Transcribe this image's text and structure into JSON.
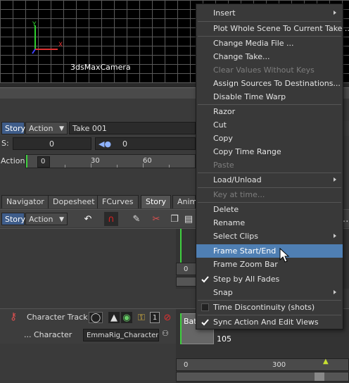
{
  "viewport": {
    "camera_label": "3dsMaxCamera"
  },
  "story_row": {
    "story": "Story",
    "action": "Action",
    "take": "Take 001"
  },
  "value_row": {
    "s_label": "S:",
    "s_value": "0",
    "field_value": "0"
  },
  "action_ruler": {
    "label": "Action",
    "start": "0",
    "ticks": [
      "30",
      "60"
    ]
  },
  "tabs": [
    "Navigator",
    "Dopesheet",
    "FCurves",
    "Story",
    "Anim"
  ],
  "toolbar": {
    "story": "Story",
    "action": "Action"
  },
  "lower_ruler": {
    "start": "0"
  },
  "tracks": {
    "character_track": "Character Track",
    "character_label": "Character",
    "character_value": "EmmaRig_Character",
    "badge": "1",
    "ellipsis": "..."
  },
  "timeline": {
    "clip_value": "105",
    "clip_prefix": "Bat",
    "bottom_start": "0",
    "bottom_mark": "300"
  },
  "context_menu": {
    "items": [
      {
        "label": "Insert",
        "submenu": true
      },
      {
        "label": "Plot Whole Scene To Current Take ..."
      },
      {
        "label": "Change Media File ..."
      },
      {
        "label": "Change Take..."
      },
      {
        "label": "Clear Values Without Keys",
        "disabled": true
      },
      {
        "label": "Assign Sources To Destinations..."
      },
      {
        "label": "Disable Time Warp"
      },
      {
        "label": "Razor"
      },
      {
        "label": "Cut"
      },
      {
        "label": "Copy"
      },
      {
        "label": "Copy Time Range"
      },
      {
        "label": "Paste",
        "disabled": true
      },
      {
        "label": "Load/Unload",
        "submenu": true
      },
      {
        "label": "Key at time...",
        "disabled": true
      },
      {
        "label": "Delete"
      },
      {
        "label": "Rename"
      },
      {
        "label": "Select Clips",
        "submenu": true
      },
      {
        "label": "Frame Start/End",
        "highlighted": true
      },
      {
        "label": "Frame Zoom Bar"
      },
      {
        "label": "Step by All Fades",
        "checked": true
      },
      {
        "label": "Snap",
        "submenu": true
      },
      {
        "label": "Time Discontinuity (shots)",
        "checkbox": true
      },
      {
        "label": "Sync Action And Edit Views",
        "checked": true
      }
    ]
  },
  "colors": {
    "menu_highlight": "#4f7fb3",
    "green_marker": "#3fd13f",
    "story_button": "#3f5d8a"
  }
}
